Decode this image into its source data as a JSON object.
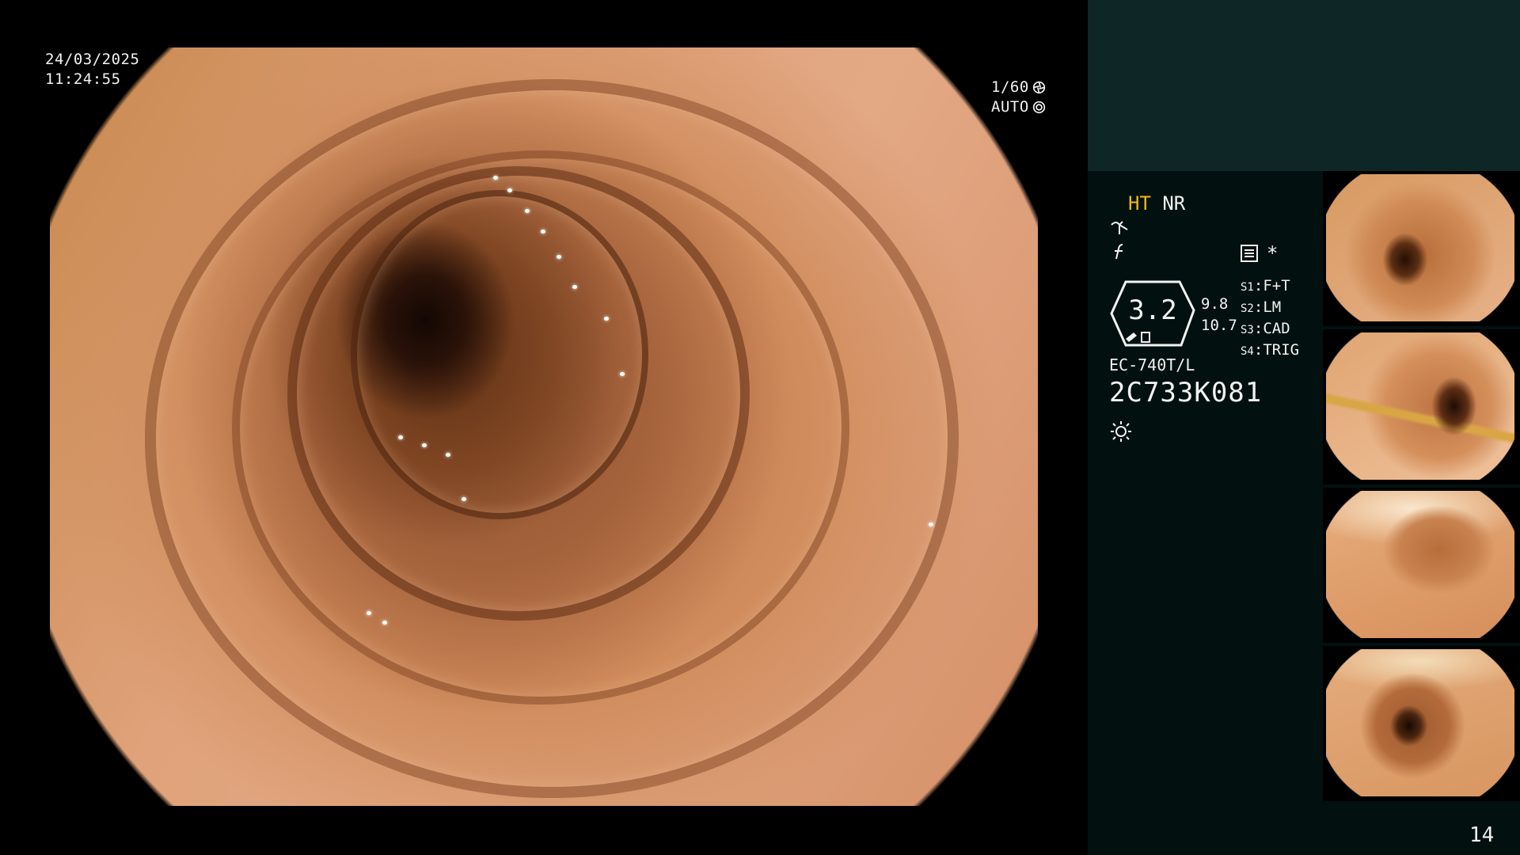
{
  "osd": {
    "date": "24/03/2025",
    "time": "11:24:55",
    "shutter": "1/60",
    "exposure_mode": "AUTO"
  },
  "panel": {
    "light_mode_primary": "HT",
    "light_mode_secondary": "NR",
    "zoom_value": "3.2",
    "zoom_secondary_a": "9.8",
    "zoom_secondary_b": "10.7",
    "switches": [
      {
        "key": "S1",
        "value": "F+T"
      },
      {
        "key": "S2",
        "value": "LM"
      },
      {
        "key": "S3",
        "value": "CAD"
      },
      {
        "key": "S4",
        "value": "TRIG"
      }
    ],
    "scope_model": "EC-740T/L",
    "scope_serial": "2C733K081",
    "star": "*",
    "page_number": "14"
  },
  "colors": {
    "panel_background": "#02110f",
    "panel_header": "#0f2627",
    "highlight_mode": "#f0b818",
    "text": "#f2f2f2"
  },
  "icons": [
    "shutter-icon",
    "auto-iris-icon",
    "enhancement-icon",
    "function-icon",
    "menu-icon",
    "zoom-badge-icon",
    "light-source-icon"
  ]
}
